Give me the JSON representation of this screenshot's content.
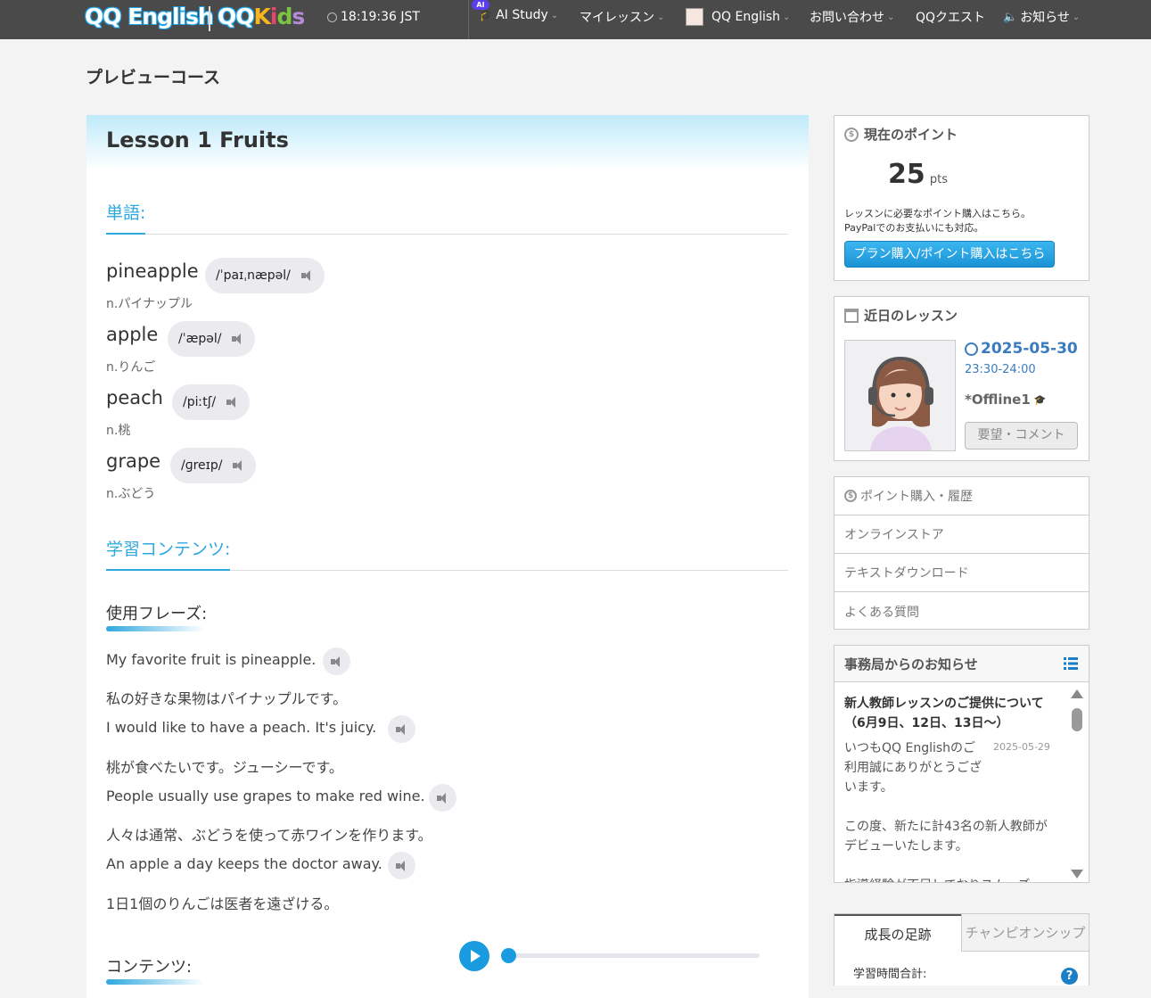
{
  "header": {
    "logo_main": "QQ English",
    "logo_kids_q": "QQ",
    "logo_kids_k": "K",
    "logo_kids_i": "i",
    "logo_kids_d": "d",
    "logo_kids_s": "s",
    "time": "18:19:36 JST",
    "ai_badge": "AI",
    "nav": [
      "AI Study",
      "マイレッスン",
      "QQ English",
      "お問い合わせ",
      "QQクエスト",
      "お知らせ"
    ]
  },
  "page": {
    "title": "プレビューコース"
  },
  "lesson": {
    "title": "Lesson 1 Fruits",
    "vocab_heading": "単語:",
    "words": [
      {
        "word": "pineapple",
        "ipa": "/ˈpaɪˌnæpəl/",
        "meaning": "n.パイナップル"
      },
      {
        "word": "apple",
        "ipa": "/ˈæpəl/",
        "meaning": "n.りんご"
      },
      {
        "word": "peach",
        "ipa": "/piːtʃ/",
        "meaning": "n.桃"
      },
      {
        "word": "grape",
        "ipa": "/ɡreɪp/",
        "meaning": "n.ぶどう"
      }
    ],
    "content_heading": "学習コンテンツ:",
    "phrases_heading": "使用フレーズ:",
    "phrases": [
      {
        "en": "My favorite fruit is pineapple.",
        "ja": "私の好きな果物はパイナップルです。"
      },
      {
        "en": "I would like to have a peach. It's juicy.",
        "ja": "桃が食べたいです。ジューシーです。"
      },
      {
        "en": "People usually use grapes to make red wine.",
        "ja": "人々は通常、ぶどうを使って赤ワインを作ります。"
      },
      {
        "en": "An apple a day keeps the doctor away.",
        "ja": "1日1個のりんごは医者を遠ざける。"
      }
    ],
    "contents_heading": "コンテンツ:"
  },
  "points": {
    "title": "現在のポイント",
    "value": "25",
    "unit": "pts",
    "note1": "レッスンに必要なポイント購入はこちら。",
    "note2": "PayPalでのお支払いにも対応。",
    "button": "プラン購入/ポイント購入はこちら"
  },
  "upcoming": {
    "title": "近日のレッスン",
    "date": "2025-05-30",
    "time": "23:30-24:00",
    "teacher": "*Offline1",
    "button": "要望・コメント"
  },
  "menu": [
    "ポイント購入・履歴",
    "オンラインストア",
    "テキストダウンロード",
    "よくある質問"
  ],
  "notice": {
    "title": "事務局からのお知らせ",
    "headline": "新人教師レッスンのご提供について（6月9日、12日、13日〜）",
    "body1": "いつもQQ Englishのご利用誠にありがとうございます。",
    "date": "2025-05-29",
    "body2": "この度、新たに計43名の新人教師がデビューいたします。",
    "body3": "指導経験が不足しておりスムーズ"
  },
  "growth": {
    "tab1": "成長の足跡",
    "tab2": "チャンピオンシップ",
    "label": "学習時間合計:"
  },
  "colors": {
    "accent": "#2fa8e0",
    "nav_bg": "#4a4a4a",
    "button_blue": "#1a93d6",
    "date_blue": "#3a7bbf"
  }
}
